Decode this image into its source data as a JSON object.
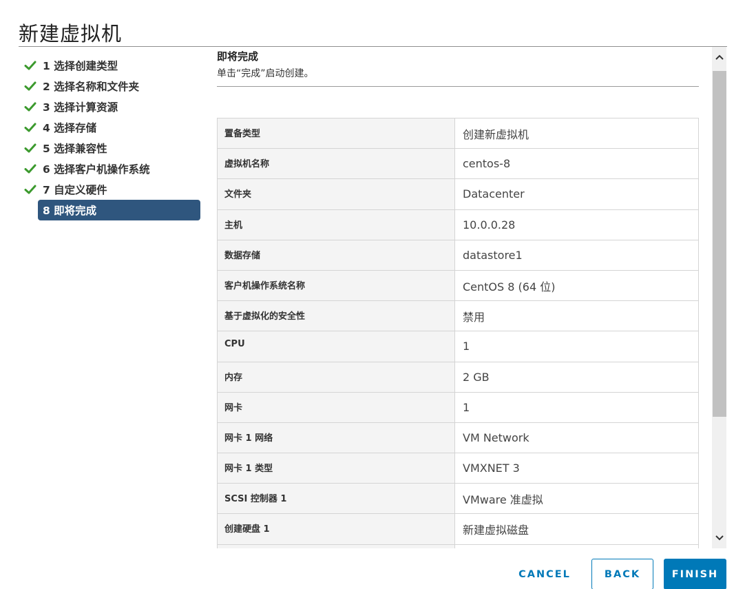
{
  "dialog": {
    "title": "新建虚拟机"
  },
  "steps": [
    {
      "label": "1 选择创建类型",
      "done": true
    },
    {
      "label": "2 选择名称和文件夹",
      "done": true
    },
    {
      "label": "3 选择计算资源",
      "done": true
    },
    {
      "label": "4 选择存储",
      "done": true
    },
    {
      "label": "5 选择兼容性",
      "done": true
    },
    {
      "label": "6 选择客户机操作系统",
      "done": true
    },
    {
      "label": "7 自定义硬件",
      "done": true
    },
    {
      "label": "8 即将完成",
      "done": false,
      "active": true
    }
  ],
  "page": {
    "heading": "即将完成",
    "subtitle": "单击“完成”启动创建。"
  },
  "summary": [
    {
      "key": "置备类型",
      "value": "创建新虚拟机"
    },
    {
      "key": "虚拟机名称",
      "value": "centos-8"
    },
    {
      "key": "文件夹",
      "value": "Datacenter"
    },
    {
      "key": "主机",
      "value": "10.0.0.28"
    },
    {
      "key": "数据存储",
      "value": "datastore1"
    },
    {
      "key": "客户机操作系统名称",
      "value": "CentOS 8 (64 位)"
    },
    {
      "key": "基于虚拟化的安全性",
      "value": "禁用"
    },
    {
      "key": "CPU",
      "value": "1"
    },
    {
      "key": "内存",
      "value": "2 GB"
    },
    {
      "key": "网卡",
      "value": "1"
    },
    {
      "key": "网卡 1 网络",
      "value": "VM Network"
    },
    {
      "key": "网卡 1 类型",
      "value": "VMXNET 3"
    },
    {
      "key": "SCSI 控制器 1",
      "value": "VMware 准虚拟"
    },
    {
      "key": "创建硬盘 1",
      "value": "新建虚拟磁盘"
    },
    {
      "key": "",
      "value": ""
    }
  ],
  "buttons": {
    "cancel": "CANCEL",
    "back": "BACK",
    "finish": "FINISH"
  },
  "colors": {
    "accent": "#0079b8",
    "active_step": "#2f567e",
    "check": "#3c9a2e"
  },
  "icons": {
    "step_done": "check-icon",
    "scroll_up": "chevron-up-icon",
    "scroll_down": "chevron-down-icon"
  }
}
